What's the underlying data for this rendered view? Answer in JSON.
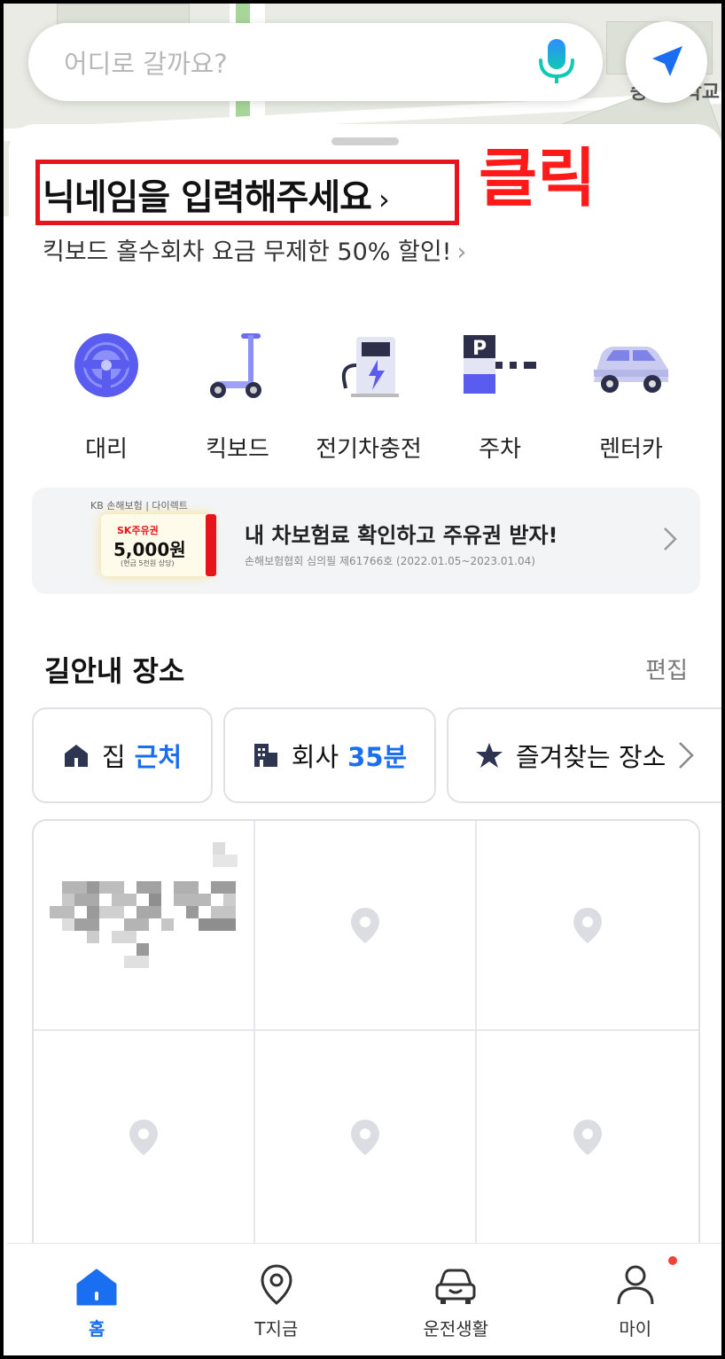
{
  "map": {
    "label": "숭평중학교",
    "road_color": "#ffffff",
    "park_color": "#a8d59a"
  },
  "search": {
    "placeholder": "어디로 갈까요?",
    "mic_icon": "mic-icon",
    "locate_icon": "navigation-arrow-icon"
  },
  "annotation": {
    "click_label": "클릭",
    "box_color": "#e8141b"
  },
  "profile": {
    "nickname_prompt": "닉네임을 입력해주세요",
    "chevron": "›",
    "promo": "킥보드 홀수회차 요금 무제한 50% 할인!",
    "promo_chevron": "›"
  },
  "services": [
    {
      "label": "대리",
      "icon": "steering-wheel-icon"
    },
    {
      "label": "킥보드",
      "icon": "kickboard-icon"
    },
    {
      "label": "전기차충전",
      "icon": "ev-charger-icon"
    },
    {
      "label": "주차",
      "icon": "parking-icon"
    },
    {
      "label": "렌터카",
      "icon": "rental-car-icon"
    }
  ],
  "banner": {
    "brand": "KB 손해보험 | 다이렉트",
    "coupon_brand": "SK주유권",
    "coupon_amount": "5,000원",
    "coupon_note": "(현금 5천원 상당)",
    "headline": "내 차보험료 확인하고 주유권 받자!",
    "disclaimer": "손해보험협회 심의필 제61766호 (2022.01.05~2023.01.04)"
  },
  "places": {
    "title": "길안내 장소",
    "edit_label": "편집",
    "chips": [
      {
        "name": "집",
        "detail": "근처",
        "icon": "home-icon"
      },
      {
        "name": "회사",
        "detail": "35분",
        "icon": "building-icon"
      },
      {
        "name": "즐겨찾는 장소",
        "detail": "",
        "icon": "star-icon"
      }
    ]
  },
  "bottom_nav": [
    {
      "label": "홈",
      "icon": "home-icon",
      "active": true
    },
    {
      "label": "T지금",
      "icon": "location-pin-icon",
      "active": false
    },
    {
      "label": "운전생활",
      "icon": "car-icon",
      "active": false
    },
    {
      "label": "마이",
      "icon": "person-icon",
      "active": false
    }
  ],
  "colors": {
    "accent": "#1a6ef0",
    "annotation_red": "#e8141b",
    "badge_red": "#f04438"
  }
}
